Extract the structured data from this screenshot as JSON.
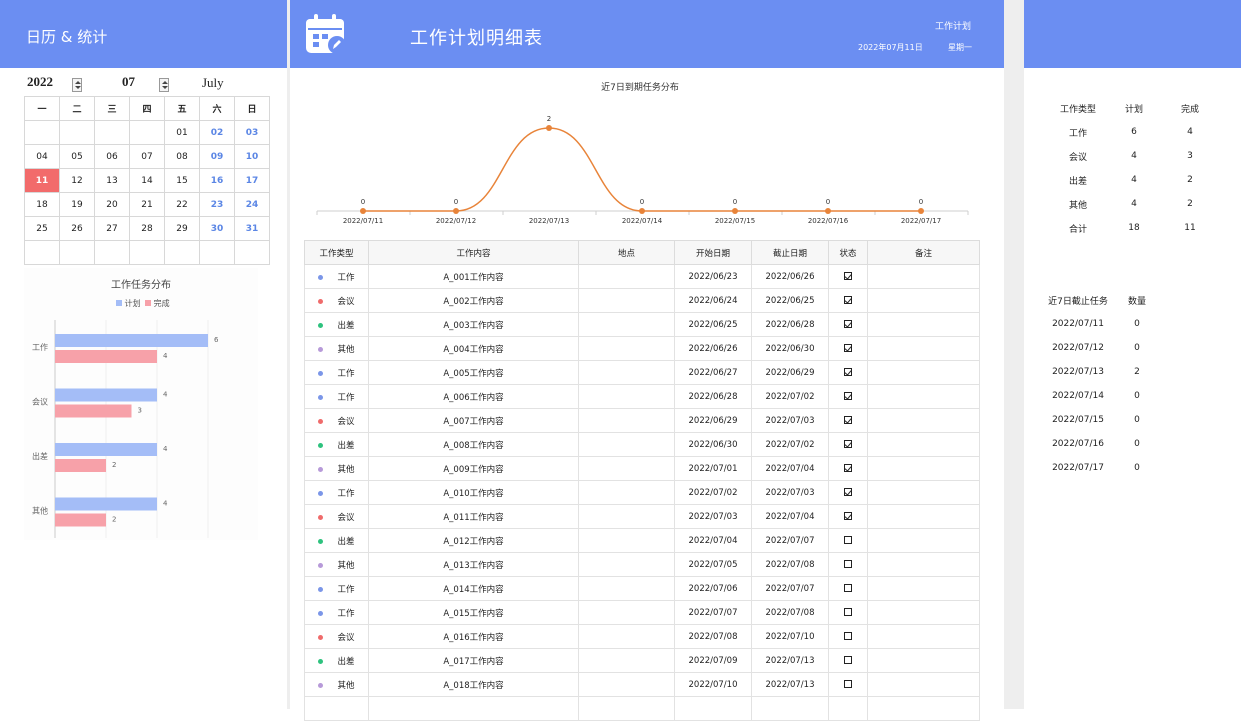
{
  "left": {
    "title": "日历 & 统计",
    "year": "2022",
    "month": "07",
    "month_name": "July",
    "weekdays": [
      "一",
      "二",
      "三",
      "四",
      "五",
      "六",
      "日"
    ],
    "weeks": [
      [
        "",
        "",
        "",
        "",
        "01",
        "02",
        "03"
      ],
      [
        "04",
        "05",
        "06",
        "07",
        "08",
        "09",
        "10"
      ],
      [
        "11",
        "12",
        "13",
        "14",
        "15",
        "16",
        "17"
      ],
      [
        "18",
        "19",
        "20",
        "21",
        "22",
        "23",
        "24"
      ],
      [
        "25",
        "26",
        "27",
        "28",
        "29",
        "30",
        "31"
      ],
      [
        "",
        "",
        "",
        "",
        "",
        "",
        ""
      ]
    ],
    "today": "11"
  },
  "header": {
    "title": "工作计划明细表",
    "subtitle": "工作计划",
    "date": "2022年07月11日",
    "weekday": "星期一",
    "icon": "calendar-edit-icon",
    "color": "#6b8ef2"
  },
  "line_chart": {
    "title": "近7日到期任务分布",
    "color": "#e8843a"
  },
  "bar_chart": {
    "title": "工作任务分布",
    "legend": [
      "计划",
      "完成"
    ],
    "colors": [
      "#a4bdf7",
      "#f7a1a9"
    ]
  },
  "chart_data": [
    {
      "type": "line",
      "title": "近7日到期任务分布",
      "x": [
        "2022/07/11",
        "2022/07/12",
        "2022/07/13",
        "2022/07/14",
        "2022/07/15",
        "2022/07/16",
        "2022/07/17"
      ],
      "values": [
        0,
        0,
        2,
        0,
        0,
        0,
        0
      ],
      "ylim": [
        0,
        2
      ]
    },
    {
      "type": "bar",
      "title": "工作任务分布",
      "categories": [
        "工作",
        "会议",
        "出差",
        "其他"
      ],
      "series": [
        {
          "name": "计划",
          "values": [
            6,
            4,
            4,
            4
          ]
        },
        {
          "name": "完成",
          "values": [
            4,
            3,
            2,
            2
          ]
        }
      ],
      "xlim": [
        0,
        8
      ]
    }
  ],
  "table": {
    "headers": [
      "工作类型",
      "工作内容",
      "地点",
      "开始日期",
      "截止日期",
      "状态",
      "备注"
    ],
    "rows": [
      {
        "type": "工作",
        "content": "A_001工作内容",
        "start": "2022/06/23",
        "end": "2022/06/26",
        "done": true
      },
      {
        "type": "会议",
        "content": "A_002工作内容",
        "start": "2022/06/24",
        "end": "2022/06/25",
        "done": true
      },
      {
        "type": "出差",
        "content": "A_003工作内容",
        "start": "2022/06/25",
        "end": "2022/06/28",
        "done": true
      },
      {
        "type": "其他",
        "content": "A_004工作内容",
        "start": "2022/06/26",
        "end": "2022/06/30",
        "done": true
      },
      {
        "type": "工作",
        "content": "A_005工作内容",
        "start": "2022/06/27",
        "end": "2022/06/29",
        "done": true
      },
      {
        "type": "工作",
        "content": "A_006工作内容",
        "start": "2022/06/28",
        "end": "2022/07/02",
        "done": true
      },
      {
        "type": "会议",
        "content": "A_007工作内容",
        "start": "2022/06/29",
        "end": "2022/07/03",
        "done": true
      },
      {
        "type": "出差",
        "content": "A_008工作内容",
        "start": "2022/06/30",
        "end": "2022/07/02",
        "done": true
      },
      {
        "type": "其他",
        "content": "A_009工作内容",
        "start": "2022/07/01",
        "end": "2022/07/04",
        "done": true
      },
      {
        "type": "工作",
        "content": "A_010工作内容",
        "start": "2022/07/02",
        "end": "2022/07/03",
        "done": true
      },
      {
        "type": "会议",
        "content": "A_011工作内容",
        "start": "2022/07/03",
        "end": "2022/07/04",
        "done": true
      },
      {
        "type": "出差",
        "content": "A_012工作内容",
        "start": "2022/07/04",
        "end": "2022/07/07",
        "done": false
      },
      {
        "type": "其他",
        "content": "A_013工作内容",
        "start": "2022/07/05",
        "end": "2022/07/08",
        "done": false
      },
      {
        "type": "工作",
        "content": "A_014工作内容",
        "start": "2022/07/06",
        "end": "2022/07/07",
        "done": false
      },
      {
        "type": "工作",
        "content": "A_015工作内容",
        "start": "2022/07/07",
        "end": "2022/07/08",
        "done": false
      },
      {
        "type": "会议",
        "content": "A_016工作内容",
        "start": "2022/07/08",
        "end": "2022/07/10",
        "done": false
      },
      {
        "type": "出差",
        "content": "A_017工作内容",
        "start": "2022/07/09",
        "end": "2022/07/13",
        "done": false
      },
      {
        "type": "其他",
        "content": "A_018工作内容",
        "start": "2022/07/10",
        "end": "2022/07/13",
        "done": false
      }
    ],
    "type_colors": {
      "工作": "#7b96e8",
      "会议": "#ef6b6b",
      "出差": "#2ec27e",
      "其他": "#b79ad9"
    }
  },
  "stats": {
    "headers": [
      "工作类型",
      "计划",
      "完成"
    ],
    "rows": [
      [
        "工作",
        "6",
        "4"
      ],
      [
        "会议",
        "4",
        "3"
      ],
      [
        "出差",
        "4",
        "2"
      ],
      [
        "其他",
        "4",
        "2"
      ],
      [
        "合计",
        "18",
        "11"
      ]
    ]
  },
  "due": {
    "headers": [
      "近7日截止任务",
      "数量"
    ],
    "rows": [
      [
        "2022/07/11",
        "0"
      ],
      [
        "2022/07/12",
        "0"
      ],
      [
        "2022/07/13",
        "2"
      ],
      [
        "2022/07/14",
        "0"
      ],
      [
        "2022/07/15",
        "0"
      ],
      [
        "2022/07/16",
        "0"
      ],
      [
        "2022/07/17",
        "0"
      ]
    ]
  }
}
